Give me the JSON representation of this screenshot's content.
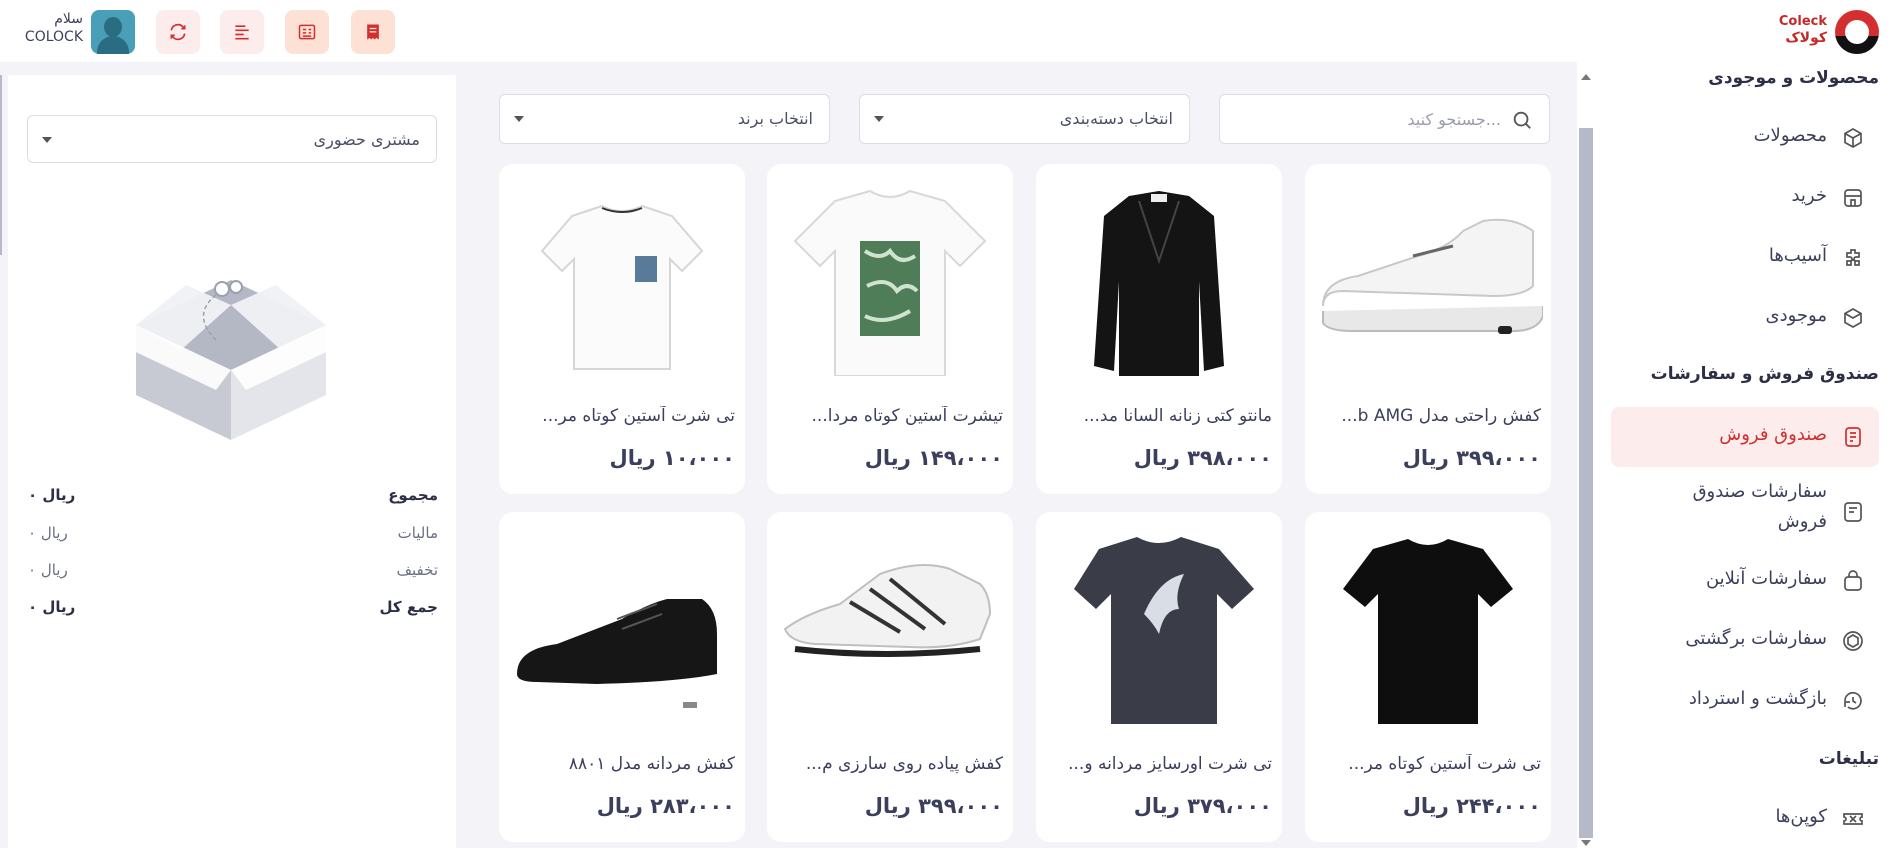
{
  "topbar": {
    "logo_en": "Coleck",
    "logo_fa": "کولاک",
    "greeting": "سلام",
    "username": "COLOCK"
  },
  "icons": {
    "refresh": "refresh-icon",
    "list_align": "align-right-icon",
    "list_detail": "list-detail-icon",
    "receipt": "receipt-icon"
  },
  "colors": {
    "accent": "#d32f2f",
    "accent_light": "#fdecec",
    "orange_light": "#fce1d4",
    "text": "#3b3f5c"
  },
  "filters": {
    "search_placeholder": "جستجو کنید...",
    "category": "انتخاب دسته‌بندی",
    "brand": "انتخاب برند"
  },
  "products": [
    {
      "name": "کفش راحتی مدل b AMG...",
      "price": "۳۹۹،۰۰۰ ریال"
    },
    {
      "name": "مانتو کتی زنانه السانا مد...",
      "price": "۳۹۸،۰۰۰ ریال"
    },
    {
      "name": "تیشرت آستین کوتاه مردا...",
      "price": "۱۴۹،۰۰۰ ریال"
    },
    {
      "name": "تی شرت آستین کوتاه مر...",
      "price": "۱۰،۰۰۰ ریال"
    },
    {
      "name": "تی شرت آستین کوتاه مر...",
      "price": "۲۴۴،۰۰۰ ریال"
    },
    {
      "name": "تی شرت اورسایز مردانه و...",
      "price": "۳۷۹،۰۰۰ ریال"
    },
    {
      "name": "کفش پیاده روی سارزی م...",
      "price": "۳۹۹،۰۰۰ ریال"
    },
    {
      "name": "کفش مردانه مدل ۸۸۰۱",
      "price": "۲۸۳،۰۰۰ ریال"
    }
  ],
  "cart": {
    "customer": "مشتری حضوری",
    "rows": [
      {
        "label": "مجموع",
        "value": "۰ ریال"
      },
      {
        "label": "مالیات",
        "value": "۰ ریال"
      },
      {
        "label": "تخفیف",
        "value": "۰ ریال"
      },
      {
        "label": "جمع کل",
        "value": "۰ ریال"
      }
    ]
  },
  "sidebar": {
    "sections": [
      "محصولات و موجودی",
      "صندوق فروش و سفارشات",
      "تبلیغات"
    ],
    "items": [
      {
        "label": "محصولات",
        "icon": "box-icon"
      },
      {
        "label": "خرید",
        "icon": "store-icon"
      },
      {
        "label": "آسیب‌ها",
        "icon": "puzzle-icon"
      },
      {
        "label": "موجودی",
        "icon": "cube-icon"
      },
      {
        "label": "صندوق فروش",
        "icon": "cash-register-icon"
      },
      {
        "label": "سفارشات صندوق",
        "label2": "فروش",
        "icon": "order-list-icon"
      },
      {
        "label": "سفارشات آنلاین",
        "icon": "shopping-bag-icon"
      },
      {
        "label": "سفارشات برگشتی",
        "icon": "return-box-icon"
      },
      {
        "label": "بازگشت و استرداد",
        "icon": "refund-icon"
      },
      {
        "label": "کوپن‌ها",
        "icon": "coupon-icon"
      }
    ]
  }
}
